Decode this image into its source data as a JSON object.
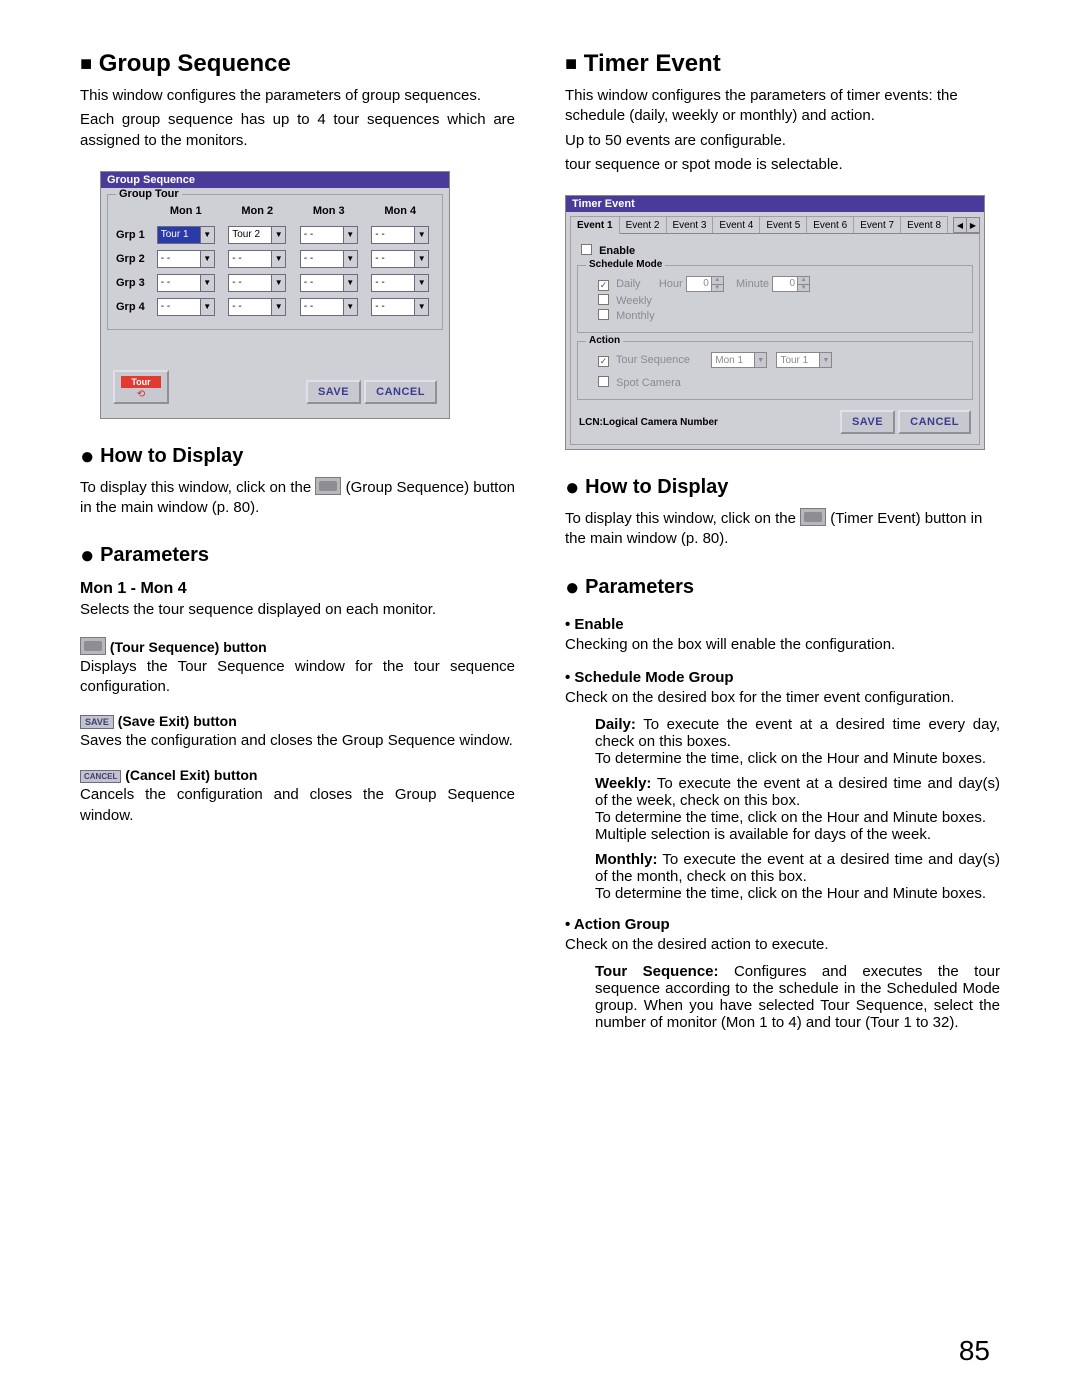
{
  "page_number": "85",
  "left": {
    "heading": "Group Sequence",
    "intro1": "This window configures the parameters of group sequences.",
    "intro2": "Each group sequence has up to 4 tour sequences which are assigned to the monitors.",
    "window": {
      "title": "Group Sequence",
      "group_tour_label": "Group Tour",
      "mon_headers": [
        "Mon 1",
        "Mon 2",
        "Mon 3",
        "Mon 4"
      ],
      "row_labels": [
        "Grp 1",
        "Grp 2",
        "Grp 3",
        "Grp 4"
      ],
      "row1": [
        "Tour 1",
        "Tour 2",
        "- -",
        "- -"
      ],
      "dash": "- -",
      "tour_btn": "Tour",
      "save": "SAVE",
      "cancel": "CANCEL"
    },
    "howto_h": "How to Display",
    "howto_p1a": "To display this window, click on the ",
    "howto_p1b": " (Group Sequence) button in the main window (p. 80).",
    "params_h": "Parameters",
    "mon_h": "Mon 1 - Mon 4",
    "mon_p": "Selects the tour sequence displayed on each monitor.",
    "tourseq_label": " (Tour Sequence) button",
    "tourseq_p": "Displays the Tour Sequence window for the tour sequence configuration.",
    "save_label": " (Save Exit) button",
    "save_mini": "SAVE",
    "save_p": "Saves the configuration and closes the Group Sequence window.",
    "cancel_label": " (Cancel Exit) button",
    "cancel_mini": "CANCEL",
    "cancel_p": "Cancels the configuration and closes the Group Sequence window."
  },
  "right": {
    "heading": "Timer Event",
    "intro1": "This window configures the parameters of timer events:  the schedule (daily, weekly or monthly) and action.",
    "intro2": "Up to 50 events are configurable.",
    "intro3": "tour sequence or spot mode is selectable.",
    "window": {
      "title": "Timer Event",
      "tabs": [
        "Event 1",
        "Event 2",
        "Event 3",
        "Event 4",
        "Event 5",
        "Event 6",
        "Event 7",
        "Event 8"
      ],
      "enable": "Enable",
      "schedule_mode": "Schedule Mode",
      "daily": "Daily",
      "weekly": "Weekly",
      "monthly": "Monthly",
      "hour": "Hour",
      "minute": "Minute",
      "hour_val": "0",
      "minute_val": "0",
      "action": "Action",
      "tour_sequence": "Tour Sequence",
      "spot_camera": "Spot Camera",
      "mon_sel": "Mon 1",
      "tour_sel": "Tour 1",
      "lcn": "LCN:Logical Camera Number",
      "save": "SAVE",
      "cancel": "CANCEL"
    },
    "howto_h": "How to Display",
    "howto_p1a": "To display this window, click on the ",
    "howto_p1b": " (Timer Event) button in the main window (p. 80).",
    "params_h": "Parameters",
    "enable_h": "• Enable",
    "enable_p": "Checking on the box will enable the configuration.",
    "sched_h": "• Schedule Mode Group",
    "sched_p": "Check on the desired box for the timer event configuration.",
    "daily_b": "Daily:",
    "daily_t": " To execute the event at a desired time every day, check on this boxes.",
    "daily_t2": "To determine the time, click on the Hour and Minute boxes.",
    "weekly_b": "Weekly:",
    "weekly_t": " To execute the event at a desired time and day(s) of the week, check on this box.",
    "weekly_t2": "To determine the time, click on the Hour and Minute boxes.",
    "weekly_t3": "Multiple selection is available for days of the week.",
    "monthly_b": "Monthly:",
    "monthly_t": " To execute the event at a desired time and day(s) of the month, check on this box.",
    "monthly_t2": "To determine the time, click on the Hour and Minute boxes.",
    "action_h": "• Action Group",
    "action_p": "Check on the desired action to execute.",
    "ts_b": "Tour Sequence:",
    "ts_t": " Configures and executes the tour sequence according to the schedule in the Scheduled Mode group. When you have selected Tour Sequence, select the number of monitor (Mon 1 to 4) and tour (Tour 1 to 32)."
  }
}
